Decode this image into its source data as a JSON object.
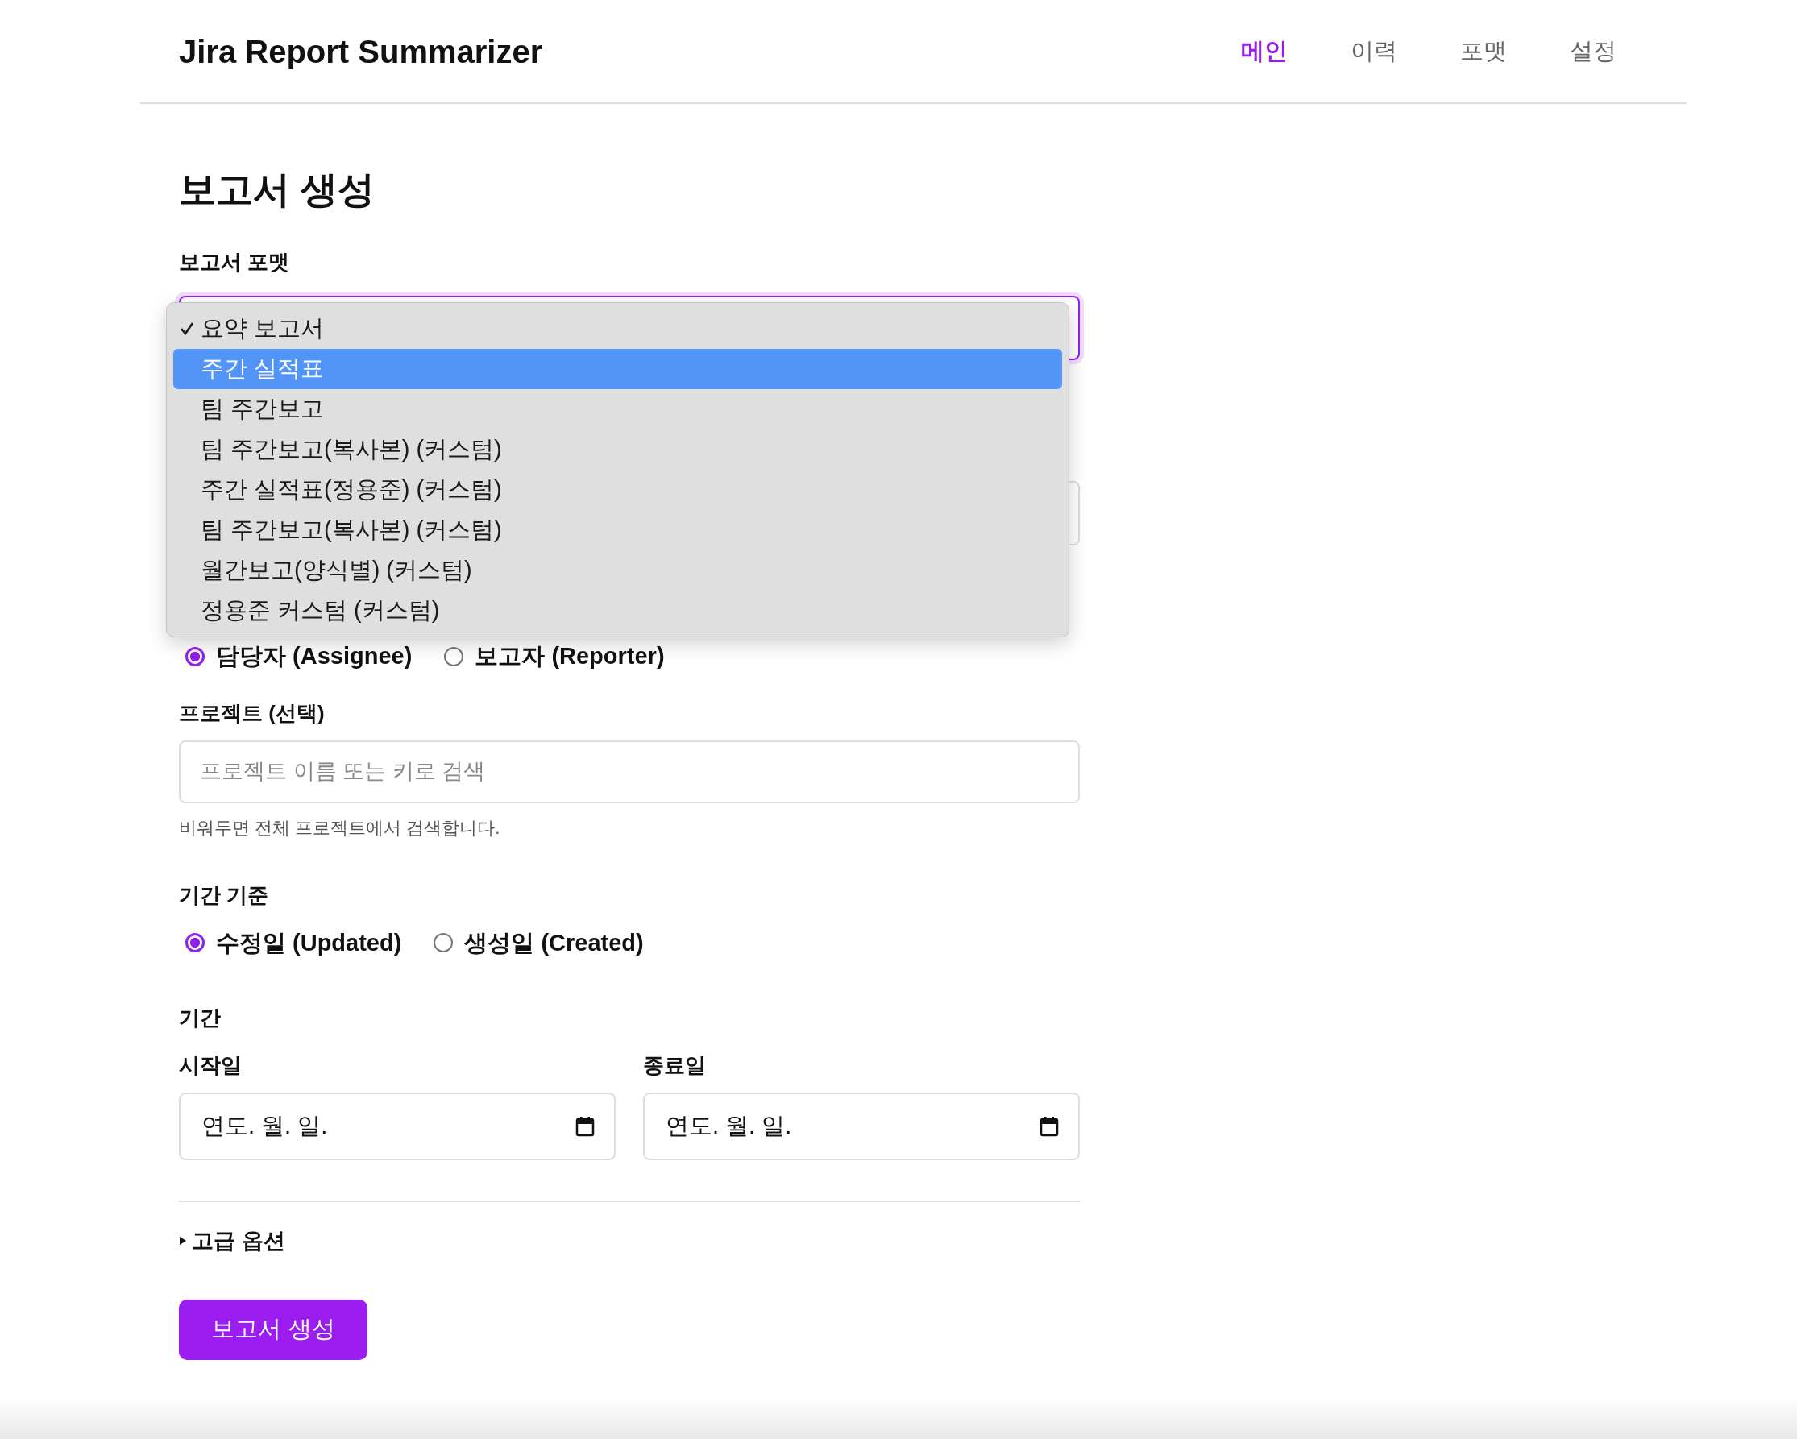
{
  "header": {
    "title": "Jira Report Summarizer",
    "nav": [
      {
        "label": "메인",
        "selected": true
      },
      {
        "label": "이력",
        "selected": false
      },
      {
        "label": "포맷",
        "selected": false
      },
      {
        "label": "설정",
        "selected": false
      }
    ]
  },
  "page_title": "보고서 생성",
  "format": {
    "label": "보고서 포맷",
    "options": [
      {
        "label": "요약 보고서",
        "selected": true,
        "highlighted": false
      },
      {
        "label": "주간 실적표",
        "selected": false,
        "highlighted": true
      },
      {
        "label": "팀 주간보고",
        "selected": false,
        "highlighted": false
      },
      {
        "label": "팀 주간보고(복사본) (커스텀)",
        "selected": false,
        "highlighted": false
      },
      {
        "label": "주간 실적표(정용준) (커스텀)",
        "selected": false,
        "highlighted": false
      },
      {
        "label": "팀 주간보고(복사본) (커스텀)",
        "selected": false,
        "highlighted": false
      },
      {
        "label": "월간보고(양식별) (커스텀)",
        "selected": false,
        "highlighted": false
      },
      {
        "label": "정용준 커스텀 (커스텀)",
        "selected": false,
        "highlighted": false
      }
    ]
  },
  "user_role": {
    "options": [
      {
        "label": "담당자 (Assignee)",
        "selected": true
      },
      {
        "label": "보고자 (Reporter)",
        "selected": false
      }
    ]
  },
  "project": {
    "label": "프로젝트 (선택)",
    "placeholder": "프로젝트 이름 또는 키로 검색",
    "help": "비워두면 전체 프로젝트에서 검색합니다."
  },
  "period_basis": {
    "label": "기간 기준",
    "options": [
      {
        "label": "수정일 (Updated)",
        "selected": true
      },
      {
        "label": "생성일 (Created)",
        "selected": false
      }
    ]
  },
  "period": {
    "label": "기간",
    "start": {
      "label": "시작일",
      "value": "연도. 월. 일."
    },
    "end": {
      "label": "종료일",
      "value": "연도. 월. 일."
    }
  },
  "advanced": {
    "label": "고급 옵션",
    "expanded": false
  },
  "submit": "보고서 생성"
}
